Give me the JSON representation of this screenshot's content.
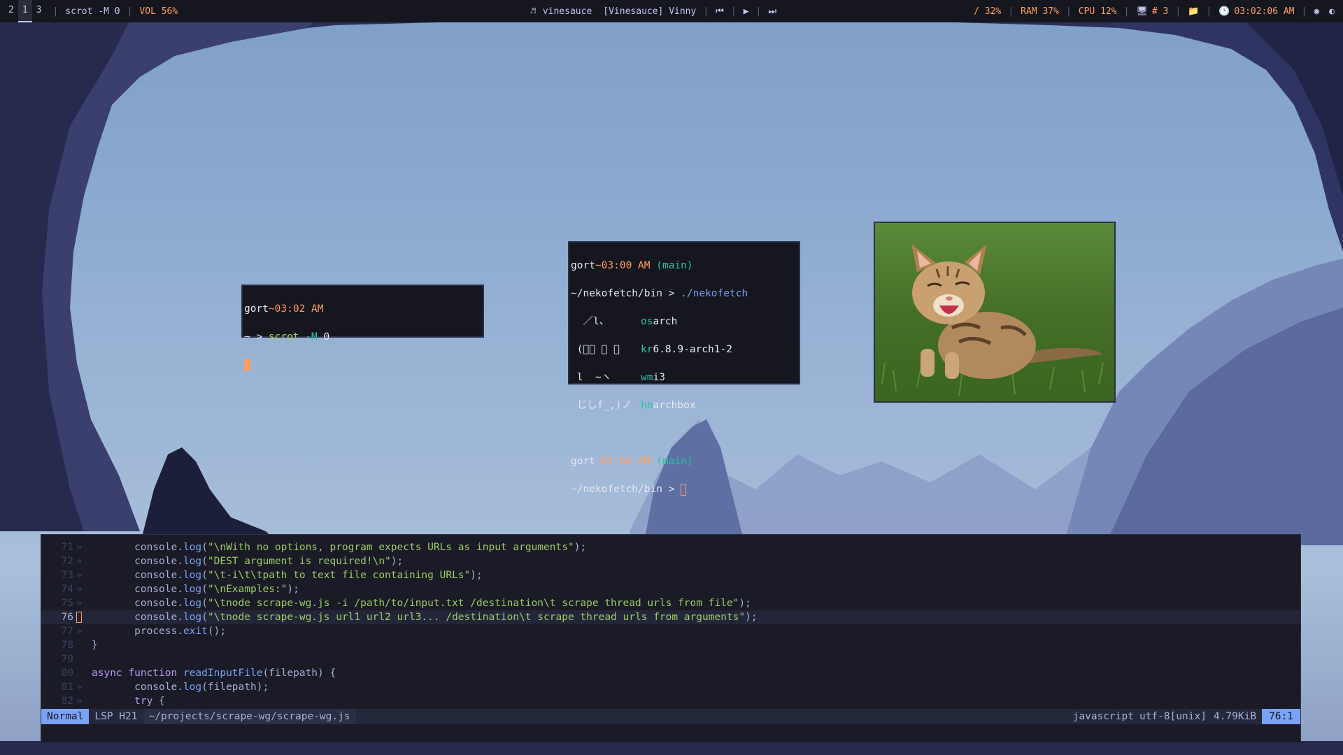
{
  "topbar": {
    "workspaces": [
      "2",
      "1",
      "3"
    ],
    "active_workspace": "1",
    "window_title": "scrot -M 0",
    "volume": "VOL 56%",
    "music_app": "vinesauce",
    "music_track": "[Vinesauce] Vinny",
    "disk": "/ 32%",
    "ram": "RAM 37%",
    "cpu": "CPU 12%",
    "display": "# 3",
    "clock": "03:02:06 AM",
    "icons": [
      "music-note-icon",
      "previous-icon",
      "play-icon",
      "next-icon",
      "monitor-icon",
      "folder-icon",
      "clock-icon",
      "discord-icon",
      "steam-icon"
    ]
  },
  "terminal_small": {
    "user": "gort",
    "time": "~03:02 AM",
    "cwd": "~",
    "prompt": ">",
    "command": "scrot",
    "flag": "-M",
    "arg": "0"
  },
  "terminal_neko": {
    "user": "gort",
    "time": "~03:00 AM",
    "branch": "(main)",
    "cwd": "~/nekofetch/bin",
    "prompt": ">",
    "command": "./nekofetch",
    "art": [
      "  ／l、",
      " (ﾟ､ ｡ ７",
      " l  ~ヽ",
      " じしf_,)ノ"
    ],
    "info": [
      {
        "key": "os",
        "value": "arch"
      },
      {
        "key": "kr",
        "value": "6.8.9-arch1-2"
      },
      {
        "key": "wm",
        "value": "i3"
      },
      {
        "key": "hn",
        "value": "archbox"
      }
    ]
  },
  "editor": {
    "lines": [
      {
        "num": "71",
        "sign": "»",
        "indent": "       ",
        "obj": "console",
        "fn": "log",
        "str": "\"\\nWith no options, program expects URLs as input arguments\"",
        "tail": ");"
      },
      {
        "num": "72",
        "sign": "»",
        "indent": "       ",
        "obj": "console",
        "fn": "log",
        "str": "\"DEST argument is required!\\n\"",
        "tail": ");"
      },
      {
        "num": "73",
        "sign": "»",
        "indent": "       ",
        "obj": "console",
        "fn": "log",
        "str": "\"\\t-i\\t\\tpath to text file containing URLs\"",
        "tail": ");"
      },
      {
        "num": "74",
        "sign": "»",
        "indent": "       ",
        "obj": "console",
        "fn": "log",
        "str": "\"\\nExamples:\"",
        "tail": ");"
      },
      {
        "num": "75",
        "sign": "»",
        "indent": "       ",
        "obj": "console",
        "fn": "log",
        "str": "\"\\tnode scrape-wg.js -i /path/to/input.txt /destination\\t scrape thread urls from file\"",
        "tail": ");"
      },
      {
        "num": "76",
        "sign": "",
        "indent": "       ",
        "obj": "console",
        "fn": "log",
        "str": "\"\\tnode scrape-wg.js url1 url2 url3... /destination\\t scrape thread urls from arguments\"",
        "tail": ");"
      },
      {
        "num": "77",
        "sign": "»",
        "indent": "       ",
        "obj": "process",
        "fn": "exit",
        "str": "",
        "tail": "();"
      }
    ],
    "line78": {
      "num": "78",
      "text": "}"
    },
    "line79": {
      "num": "79",
      "text": ""
    },
    "line80": {
      "num": "80",
      "kw": "async",
      "kw2": "function",
      "fname": "readInputFile",
      "params": "(filepath) {"
    },
    "line81": {
      "num": "81",
      "sign": "»",
      "indent": "       ",
      "obj": "console",
      "fn": "log",
      "arg": "(filepath);"
    },
    "line82": {
      "num": "82",
      "sign": "»",
      "indent": "       ",
      "kw": "try",
      "tail": " {"
    },
    "current_line": "76",
    "status": {
      "mode": "Normal",
      "lsp": "LSP H21",
      "file": "~/projects/scrape-wg/scrape-wg.js",
      "filetype": "javascript",
      "encoding": "utf-8[unix]",
      "size": "4.79KiB",
      "position": "76:1"
    }
  },
  "colors": {
    "accent": "#7aa2f7",
    "orange": "#ff9e64",
    "teal": "#2ac3a2",
    "string": "#9ece6a",
    "bar_bg": "#15161e"
  }
}
